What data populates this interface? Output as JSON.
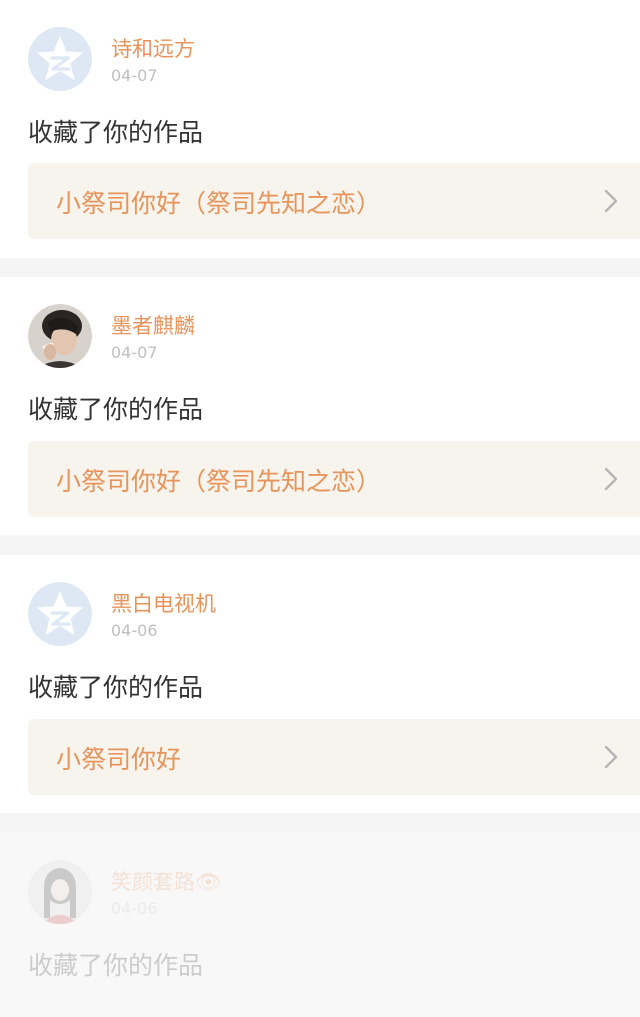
{
  "action_text": "收藏了你的作品",
  "colors": {
    "accent": "#e8935a",
    "tab_indicator": "#e9739a",
    "work_bg": "#f6f4ec"
  },
  "notifications": [
    {
      "user": "诗和远方",
      "date": "04-07",
      "avatar_icon": "qzone-star-icon",
      "work_title": "小祭司你好（祭司先知之恋）"
    },
    {
      "user": "墨者麒麟",
      "date": "04-07",
      "avatar_icon": "user-photo",
      "work_title": "小祭司你好（祭司先知之恋）"
    },
    {
      "user": "黑白电视机",
      "date": "04-06",
      "avatar_icon": "qzone-star-icon",
      "work_title": "小祭司你好"
    },
    {
      "user": "笑颜套路👁",
      "date": "04-06",
      "avatar_icon": "user-photo"
    }
  ]
}
